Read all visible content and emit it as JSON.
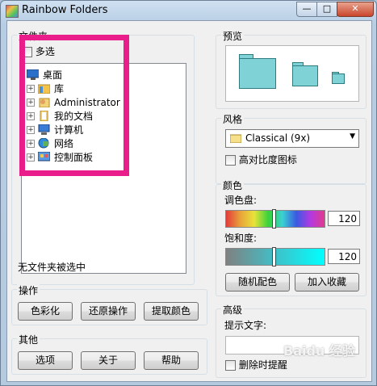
{
  "window": {
    "title": "Rainbow Folders",
    "min_glyph": "—",
    "max_glyph": "□",
    "close_glyph": "✕"
  },
  "folders_group": {
    "label": "文件夹",
    "multi_select_label": "多选",
    "multi_select_checked": false,
    "tree": [
      {
        "label": "桌面",
        "icon": "desktop-icon",
        "expandable": false
      },
      {
        "label": "库",
        "icon": "library-folder-icon",
        "expandable": true
      },
      {
        "label": "Administrator",
        "icon": "user-folder-icon",
        "expandable": true
      },
      {
        "label": "我的文档",
        "icon": "documents-icon",
        "expandable": true
      },
      {
        "label": "计算机",
        "icon": "computer-icon",
        "expandable": true
      },
      {
        "label": "网络",
        "icon": "network-icon",
        "expandable": true
      },
      {
        "label": "控制面板",
        "icon": "control-panel-icon",
        "expandable": true
      }
    ],
    "status": "无文件夹被选中"
  },
  "operations_group": {
    "label": "操作",
    "buttons": [
      "色彩化",
      "还原操作",
      "提取颜色"
    ]
  },
  "other_group": {
    "label": "其他",
    "buttons": [
      "选项",
      "关于",
      "帮助"
    ]
  },
  "preview_group": {
    "label": "预览",
    "folder_color": "#7fd3d7"
  },
  "style_group": {
    "label": "风格",
    "selected": "Classical (9x)",
    "high_contrast_label": "高对比度图标",
    "high_contrast_checked": false
  },
  "color_group": {
    "label": "颜色",
    "hue_label": "调色盘:",
    "hue_value": "120",
    "saturation_label": "饱和度:",
    "saturation_value": "120",
    "random_button": "随机配色",
    "add_favorite_button": "加入收藏"
  },
  "advanced_group": {
    "label": "高级",
    "tip_label": "提示文字:",
    "tip_value": "",
    "delete_remind_label": "删除时提醒",
    "delete_remind_checked": false
  },
  "highlight_color": "#ea1e8b",
  "watermark": "Baidu 经验"
}
